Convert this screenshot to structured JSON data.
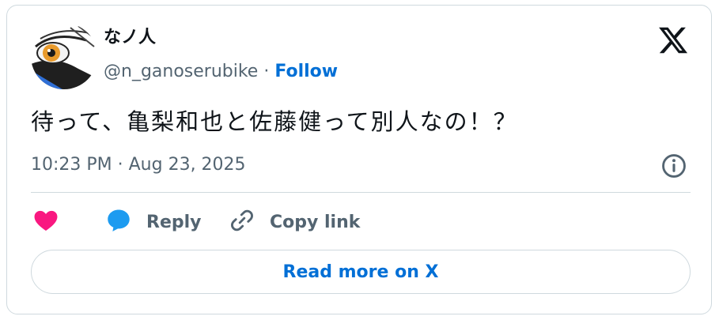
{
  "author": {
    "name": "なノ人",
    "handle": "@n_ganoserubike",
    "separator": " · ",
    "follow_label": "Follow"
  },
  "tweet": {
    "text": "待って、亀梨和也と佐藤健って別人なの！？",
    "timestamp": "10:23 PM · Aug 23, 2025"
  },
  "actions": {
    "like_icon": "heart-icon",
    "reply_label": "Reply",
    "reply_icon": "speech-bubble-icon",
    "copy_label": "Copy link",
    "copy_icon": "link-icon"
  },
  "footer": {
    "read_more_label": "Read more on X"
  },
  "icons": {
    "logo": "x-logo-icon",
    "info": "info-icon"
  },
  "colors": {
    "accent": "#006fd6",
    "like": "#f91880",
    "reply": "#1d9bf0",
    "text": "#0f1419",
    "muted": "#536471",
    "border": "#cfd9de"
  }
}
